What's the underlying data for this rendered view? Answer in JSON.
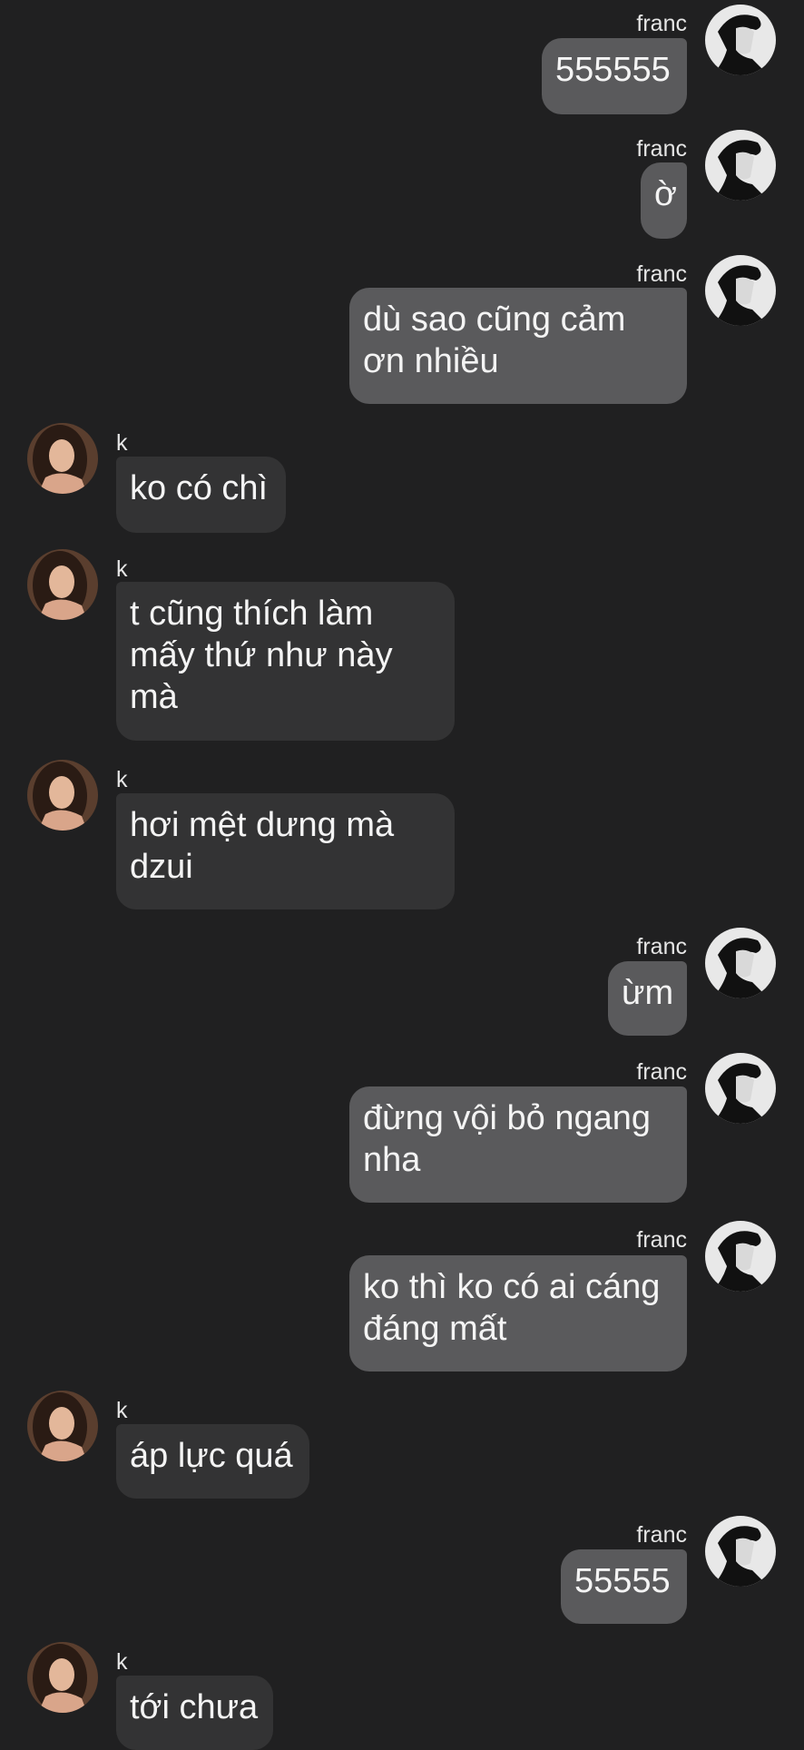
{
  "self_name": "franc",
  "other_name": "k",
  "colors": {
    "background": "#202021",
    "outgoing_bubble": "#5a5a5c",
    "incoming_bubble": "#333334",
    "text": "#f4f4f4"
  },
  "messages": [
    {
      "from": "franc",
      "text": "555555"
    },
    {
      "from": "franc",
      "text": "ờ"
    },
    {
      "from": "franc",
      "text": "dù sao cũng cảm ơn nhiều"
    },
    {
      "from": "k",
      "text": "ko có chì"
    },
    {
      "from": "k",
      "text": "t cũng thích làm mấy thứ như này mà"
    },
    {
      "from": "k",
      "text": "hơi mệt dưng mà dzui"
    },
    {
      "from": "franc",
      "text": "ừm"
    },
    {
      "from": "franc",
      "text": "đừng vội bỏ ngang nha"
    },
    {
      "from": "franc",
      "text": "ko thì ko có ai cáng đáng mất"
    },
    {
      "from": "k",
      "text": "áp lực quá"
    },
    {
      "from": "franc",
      "text": "55555"
    },
    {
      "from": "k",
      "text": "tới chưa"
    }
  ]
}
